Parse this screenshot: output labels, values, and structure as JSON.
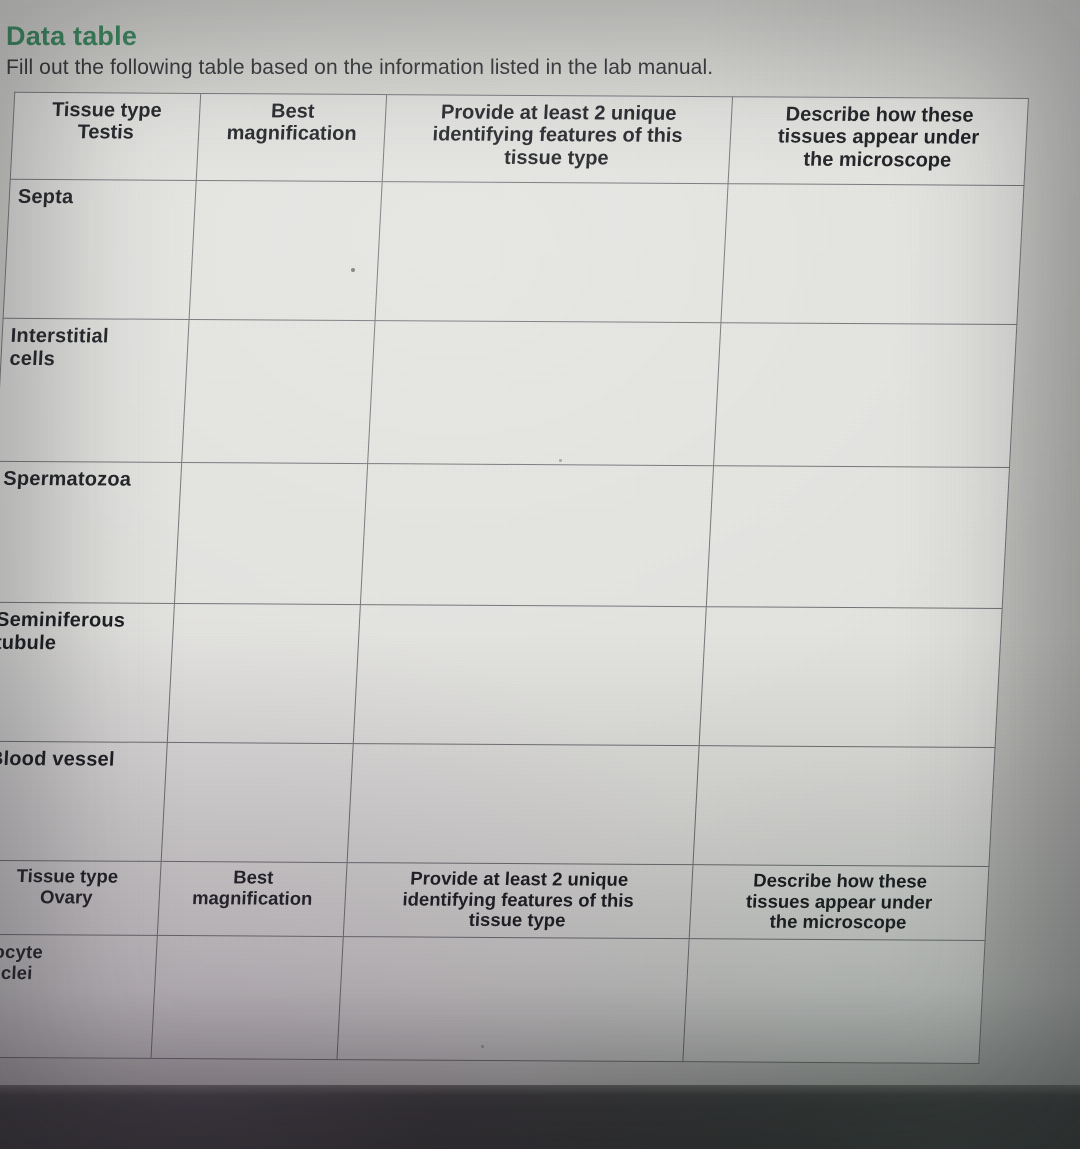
{
  "document": {
    "title": "Data table",
    "title_color": "#2d8053",
    "instruction": "Fill out the following table based on the information listed in the lab manual."
  },
  "tables": [
    {
      "id": "testis-table",
      "headers": [
        "Tissue type\nTestis",
        "Best\nmagnification",
        "Provide at least 2 unique identifying features of this tissue type",
        "Describe how these tissues appear under the microscope"
      ],
      "header_lines": {
        "col1_line1": "Tissue type",
        "col1_line2": "Testis",
        "col2_line1": "Best",
        "col2_line2": "magnification",
        "col3_line1": "Provide at least 2 unique",
        "col3_line2": "identifying features of this",
        "col3_line3": "tissue type",
        "col4_line1": "Describe how these",
        "col4_line2": "tissues appear under",
        "col4_line3": "the microscope"
      },
      "rows": [
        {
          "label": "Septa",
          "label_line2": "",
          "magnification": "",
          "features": "",
          "appearance": ""
        },
        {
          "label": "Interstitial",
          "label_line2": "cells",
          "magnification": "",
          "features": "",
          "appearance": ""
        },
        {
          "label": "Spermatozoa",
          "label_line2": "",
          "magnification": "",
          "features": "",
          "appearance": ""
        },
        {
          "label": "Seminiferous",
          "label_line2": "tubule",
          "magnification": "",
          "features": "",
          "appearance": ""
        },
        {
          "label": "Blood vessel",
          "label_line2": "",
          "magnification": "",
          "features": "",
          "appearance": ""
        }
      ]
    },
    {
      "id": "ovary-table",
      "header_lines": {
        "col1_line1": "Tissue type",
        "col1_line2": "Ovary",
        "col2_line1": "Best",
        "col2_line2": "magnification",
        "col3_line1": "Provide at least 2 unique",
        "col3_line2": "identifying features of this",
        "col3_line3": "tissue type",
        "col4_line1": "Describe how these",
        "col4_line2": "tissues appear under",
        "col4_line3": "the microscope"
      },
      "rows": [
        {
          "label": "Oocyte",
          "label_line2": "nuclei",
          "magnification": "",
          "features": "",
          "appearance": ""
        }
      ]
    }
  ],
  "colors": {
    "header_fill": "#b2b2af",
    "row_label_fill": "#9e9f9e",
    "cell_fill": "#e4e4e1",
    "border": "#6e7073",
    "text": "#14161a",
    "page_background": "#d9d9d4"
  }
}
